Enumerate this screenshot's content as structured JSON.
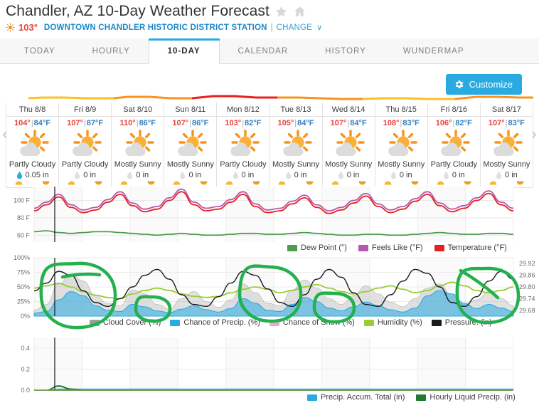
{
  "header": {
    "title": "Chandler, AZ 10-Day Weather Forecast",
    "star_icon": "star-icon",
    "home_icon": "home-icon",
    "current_temp": "103°",
    "station": "DOWNTOWN CHANDLER HISTORIC DISTRICT STATION",
    "separator": "|",
    "change_label": "CHANGE",
    "chevron": "∨"
  },
  "tabs": [
    {
      "label": "TODAY",
      "active": false
    },
    {
      "label": "HOURLY",
      "active": false
    },
    {
      "label": "10-DAY",
      "active": true
    },
    {
      "label": "CALENDAR",
      "active": false
    },
    {
      "label": "HISTORY",
      "active": false
    },
    {
      "label": "WUNDERMAP",
      "active": false
    }
  ],
  "toolbar": {
    "customize_label": "Customize",
    "customize_color": "#29abe2"
  },
  "nav": {
    "prev": "‹",
    "next": "›"
  },
  "forecast_days": [
    {
      "day": "Thu 8/8",
      "high": "104°",
      "sep": "|",
      "low": "84°F",
      "condition": "Partly Cloudy",
      "precip": "0.05 in",
      "has_precip": true
    },
    {
      "day": "Fri 8/9",
      "high": "107°",
      "sep": "|",
      "low": "87°F",
      "condition": "Partly Cloudy",
      "precip": "0 in",
      "has_precip": false
    },
    {
      "day": "Sat 8/10",
      "high": "110°",
      "sep": "|",
      "low": "86°F",
      "condition": "Mostly Sunny",
      "precip": "0 in",
      "has_precip": false
    },
    {
      "day": "Sun 8/11",
      "high": "107°",
      "sep": "|",
      "low": "86°F",
      "condition": "Mostly Sunny",
      "precip": "0 in",
      "has_precip": false
    },
    {
      "day": "Mon 8/12",
      "high": "103°",
      "sep": "|",
      "low": "82°F",
      "condition": "Partly Cloudy",
      "precip": "0 in",
      "has_precip": false
    },
    {
      "day": "Tue 8/13",
      "high": "105°",
      "sep": "|",
      "low": "84°F",
      "condition": "Mostly Sunny",
      "precip": "0 in",
      "has_precip": false
    },
    {
      "day": "Wed 8/14",
      "high": "107°",
      "sep": "|",
      "low": "84°F",
      "condition": "Mostly Sunny",
      "precip": "0 in",
      "has_precip": false
    },
    {
      "day": "Thu 8/15",
      "high": "108°",
      "sep": "|",
      "low": "83°F",
      "condition": "Mostly Sunny",
      "precip": "0 in",
      "has_precip": false
    },
    {
      "day": "Fri 8/16",
      "high": "106°",
      "sep": "|",
      "low": "82°F",
      "condition": "Partly Cloudy",
      "precip": "0 in",
      "has_precip": false
    },
    {
      "day": "Sat 8/17",
      "high": "107°",
      "sep": "|",
      "low": "83°F",
      "condition": "Mostly Sunny",
      "precip": "0 in",
      "has_precip": false
    }
  ],
  "chart_data": [
    {
      "type": "line",
      "name": "temperature-chart",
      "title": "",
      "xlabel": "",
      "ylabel": "",
      "ytick_labels": [
        "100 F",
        "80 F",
        "60 F"
      ],
      "ytick_values": [
        100,
        80,
        60
      ],
      "ylim": [
        52,
        116
      ],
      "grid": true,
      "legend_position": "bottom-right",
      "x": [
        0,
        1,
        2,
        3,
        4,
        5,
        6,
        7,
        8,
        9,
        10,
        11,
        12,
        13,
        14,
        15,
        16,
        17,
        18,
        19,
        20,
        21,
        22,
        23,
        24,
        25,
        26,
        27,
        28,
        29,
        30,
        31,
        32,
        33,
        34,
        35,
        36,
        37,
        38,
        39
      ],
      "series": [
        {
          "name": "Temperature (°F)",
          "color": "#e8201f",
          "unit": "°F",
          "values": [
            88,
            95,
            104,
            92,
            86,
            89,
            98,
            107,
            94,
            87,
            90,
            100,
            110,
            95,
            88,
            90,
            98,
            107,
            93,
            86,
            88,
            96,
            103,
            92,
            85,
            89,
            97,
            105,
            93,
            86,
            90,
            99,
            107,
            94,
            87,
            91,
            100,
            108,
            95,
            88
          ]
        },
        {
          "name": "Feels Like (°F)",
          "color": "#b657b0",
          "unit": "°F",
          "values": [
            91,
            98,
            107,
            95,
            89,
            92,
            101,
            110,
            97,
            90,
            93,
            103,
            113,
            98,
            91,
            93,
            101,
            110,
            96,
            89,
            91,
            99,
            106,
            95,
            88,
            92,
            100,
            108,
            96,
            89,
            93,
            102,
            110,
            97,
            90,
            94,
            103,
            111,
            98,
            91
          ]
        },
        {
          "name": "Dew Point (°)",
          "color": "#4f9b4f",
          "unit": "°",
          "values": [
            64,
            65,
            63,
            62,
            63,
            64,
            64,
            63,
            62,
            61,
            60,
            61,
            62,
            61,
            60,
            60,
            61,
            62,
            62,
            61,
            61,
            62,
            63,
            62,
            61,
            60,
            60,
            61,
            61,
            60,
            60,
            61,
            62,
            63,
            62,
            61,
            61,
            62,
            62,
            61
          ]
        }
      ]
    },
    {
      "type": "area",
      "name": "conditions-chart",
      "title": "",
      "xlabel": "",
      "ylabel": "",
      "ytick_labels": [
        "100%",
        "75%",
        "50%",
        "25%",
        "0%"
      ],
      "ytick_values": [
        100,
        75,
        50,
        25,
        0
      ],
      "ylim": [
        0,
        100
      ],
      "y2tick_labels": [
        "29.92",
        "29.86",
        "29.80",
        "29.74",
        "29.68"
      ],
      "y2tick_values": [
        29.92,
        29.86,
        29.8,
        29.74,
        29.68
      ],
      "y2lim": [
        29.65,
        29.95
      ],
      "grid": true,
      "legend_position": "bottom",
      "x": [
        0,
        1,
        2,
        3,
        4,
        5,
        6,
        7,
        8,
        9,
        10,
        11,
        12,
        13,
        14,
        15,
        16,
        17,
        18,
        19,
        20,
        21,
        22,
        23,
        24,
        25,
        26,
        27,
        28,
        29,
        30,
        31,
        32,
        33,
        34,
        35,
        36,
        37,
        38,
        39
      ],
      "series": [
        {
          "name": "Cloud Cover (%)",
          "color": "#bdbdbd",
          "fill": true,
          "values": [
            10,
            20,
            55,
            72,
            60,
            35,
            22,
            18,
            45,
            38,
            20,
            12,
            30,
            42,
            25,
            15,
            28,
            55,
            40,
            22,
            18,
            45,
            62,
            48,
            30,
            20,
            35,
            52,
            38,
            24,
            16,
            30,
            48,
            55,
            35,
            20,
            28,
            42,
            30,
            18
          ]
        },
        {
          "name": "Chance of Precip. (%)",
          "color": "#29abe2",
          "fill": true,
          "values": [
            5,
            8,
            28,
            42,
            35,
            18,
            10,
            8,
            20,
            16,
            9,
            6,
            12,
            18,
            11,
            7,
            13,
            30,
            22,
            10,
            8,
            20,
            32,
            25,
            14,
            9,
            16,
            24,
            18,
            11,
            7,
            14,
            35,
            44,
            38,
            22,
            13,
            20,
            14,
            8
          ]
        },
        {
          "name": "Chance of Snow (%)",
          "color": "#e9a8d6",
          "fill": true,
          "values": [
            0,
            0,
            0,
            0,
            0,
            0,
            0,
            0,
            0,
            0,
            0,
            0,
            0,
            0,
            0,
            0,
            0,
            0,
            0,
            0,
            0,
            0,
            0,
            0,
            0,
            0,
            0,
            0,
            0,
            0,
            0,
            0,
            0,
            0,
            0,
            0,
            0,
            0,
            0,
            0
          ]
        },
        {
          "name": "Humidity (%)",
          "color": "#9acd32",
          "fill": false,
          "values": [
            48,
            52,
            56,
            50,
            42,
            36,
            32,
            30,
            38,
            44,
            48,
            44,
            38,
            34,
            32,
            34,
            40,
            46,
            50,
            46,
            40,
            44,
            50,
            54,
            48,
            42,
            38,
            42,
            48,
            52,
            46,
            40,
            44,
            52,
            58,
            52,
            44,
            40,
            44,
            50
          ]
        },
        {
          "name": "Pressure. (in)",
          "color": "#1a1a1a",
          "fill": false,
          "axis": "right",
          "values": [
            29.78,
            29.82,
            29.88,
            29.86,
            29.78,
            29.72,
            29.7,
            29.74,
            29.8,
            29.86,
            29.89,
            29.84,
            29.76,
            29.71,
            29.7,
            29.75,
            29.82,
            29.88,
            29.86,
            29.79,
            29.72,
            29.7,
            29.76,
            29.84,
            29.89,
            29.85,
            29.77,
            29.71,
            29.7,
            29.76,
            29.83,
            29.89,
            29.87,
            29.8,
            29.72,
            29.7,
            29.75,
            29.83,
            29.88,
            29.84
          ]
        }
      ]
    },
    {
      "type": "line",
      "name": "precipitation-chart",
      "title": "",
      "xlabel": "",
      "ylabel": "",
      "ytick_labels": [
        "0.4",
        "0.2",
        "0.0"
      ],
      "ytick_values": [
        0.4,
        0.2,
        0.0
      ],
      "ylim": [
        0,
        0.5
      ],
      "grid": true,
      "legend_position": "bottom-right",
      "x": [
        0,
        1,
        2,
        3,
        4,
        5,
        6,
        7,
        8,
        9,
        10,
        11,
        12,
        13,
        14,
        15,
        16,
        17,
        18,
        19,
        20,
        21,
        22,
        23,
        24,
        25,
        26,
        27,
        28,
        29,
        30,
        31,
        32,
        33,
        34,
        35,
        36,
        37,
        38,
        39
      ],
      "series": [
        {
          "name": "Precip. Accum. Total (in)",
          "color": "#29abe2",
          "values": [
            0,
            0,
            0.01,
            0.01,
            0.01,
            0.01,
            0.01,
            0.01,
            0.01,
            0.01,
            0.01,
            0.01,
            0.01,
            0.01,
            0.01,
            0.01,
            0.01,
            0.01,
            0.01,
            0.01,
            0.01,
            0.01,
            0.01,
            0.01,
            0.01,
            0.01,
            0.01,
            0.01,
            0.01,
            0.01,
            0.01,
            0.01,
            0.01,
            0.01,
            0.01,
            0.01,
            0.01,
            0.01,
            0.01,
            0.01
          ]
        },
        {
          "name": "Hourly Liquid Precip. (in)",
          "color": "#1e7a32",
          "values": [
            0,
            0,
            0.04,
            0.01,
            0,
            0,
            0,
            0,
            0,
            0,
            0,
            0,
            0,
            0,
            0,
            0,
            0,
            0,
            0,
            0,
            0,
            0,
            0,
            0,
            0,
            0,
            0,
            0,
            0,
            0,
            0,
            0,
            0,
            0,
            0,
            0,
            0,
            0,
            0,
            0
          ]
        }
      ]
    }
  ],
  "annotations": {
    "color": "#22b14c",
    "shapes": [
      {
        "name": "annotation-circle-1",
        "type": "ellipse"
      },
      {
        "name": "annotation-circle-2",
        "type": "ellipse"
      },
      {
        "name": "annotation-circle-3",
        "type": "ellipse"
      },
      {
        "name": "annotation-circle-4",
        "type": "ellipse"
      },
      {
        "name": "annotation-circle-5",
        "type": "ellipse"
      }
    ]
  }
}
